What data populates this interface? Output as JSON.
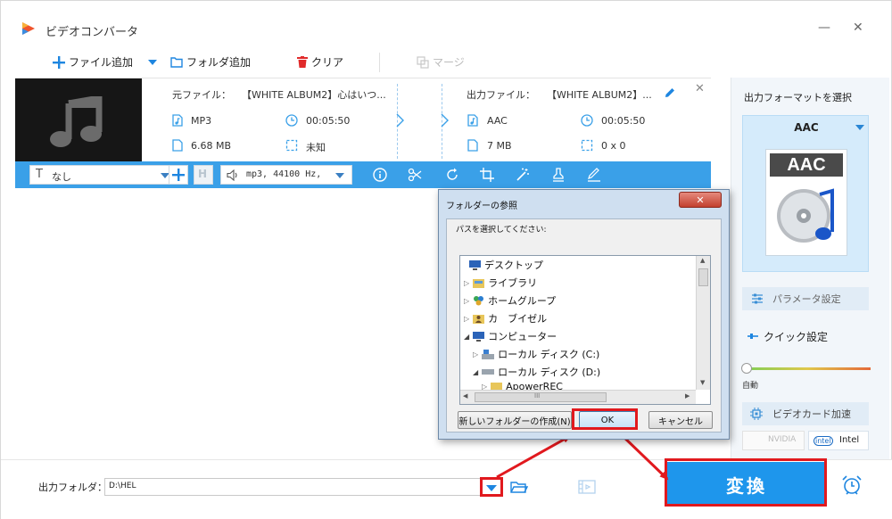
{
  "app": {
    "title": "ビデオコンバータ"
  },
  "toolbar": {
    "add_file": "ファイル追加",
    "add_folder": "フォルダ追加",
    "clear": "クリア",
    "merge": "マージ"
  },
  "file": {
    "source_label": "元ファイル：",
    "source_name": "【WHITE ALBUM2】心はいつ...",
    "output_label": "出力ファイル：",
    "output_name": "【WHITE ALBUM2】...",
    "src_format": "MP3",
    "src_duration": "00:05:50",
    "src_size": "6.68 MB",
    "src_resolution": "未知",
    "out_format": "AAC",
    "out_duration": "00:05:50",
    "out_size": "7 MB",
    "out_resolution": "0 x 0"
  },
  "options": {
    "subtitle": "なし",
    "audio": "mp3, 44100 Hz,"
  },
  "right_panel": {
    "heading": "出力フォーマットを選択",
    "format": "AAC",
    "format_icon_text": "AAC",
    "param_settings": "パラメータ設定",
    "quick_settings": "クイック設定",
    "auto_label": "自動",
    "gpu_accel": "ビデオカード加速",
    "nvidia": "NVIDIA",
    "intel": "Intel"
  },
  "bottom": {
    "output_folder_label": "出力フォルダ：",
    "output_path": "D:\\HEL",
    "convert": "変換"
  },
  "dialog": {
    "title": "フォルダーの参照",
    "prompt": "パスを選択してください:",
    "tree": [
      {
        "label": "デスクトップ",
        "expander": ""
      },
      {
        "label": "ライブラリ",
        "expander": "▷"
      },
      {
        "label": "ホームグループ",
        "expander": "▷"
      },
      {
        "label": "カ　ブイゼル",
        "expander": "▷"
      },
      {
        "label": "コンピューター",
        "expander": "◢"
      },
      {
        "label": "ローカル ディスク (C:)",
        "expander": "▷"
      },
      {
        "label": "ローカル ディスク (D:)",
        "expander": "◢"
      },
      {
        "label": "ApowerREC",
        "expander": "▷"
      }
    ],
    "new_folder": "新しいフォルダーの作成(N)",
    "ok": "OK",
    "cancel": "キャンセル",
    "scroll_grip": "III"
  },
  "colors": {
    "accent": "#3aa0e8",
    "convert_bg": "#1e96ec",
    "highlight": "#e1191e"
  }
}
